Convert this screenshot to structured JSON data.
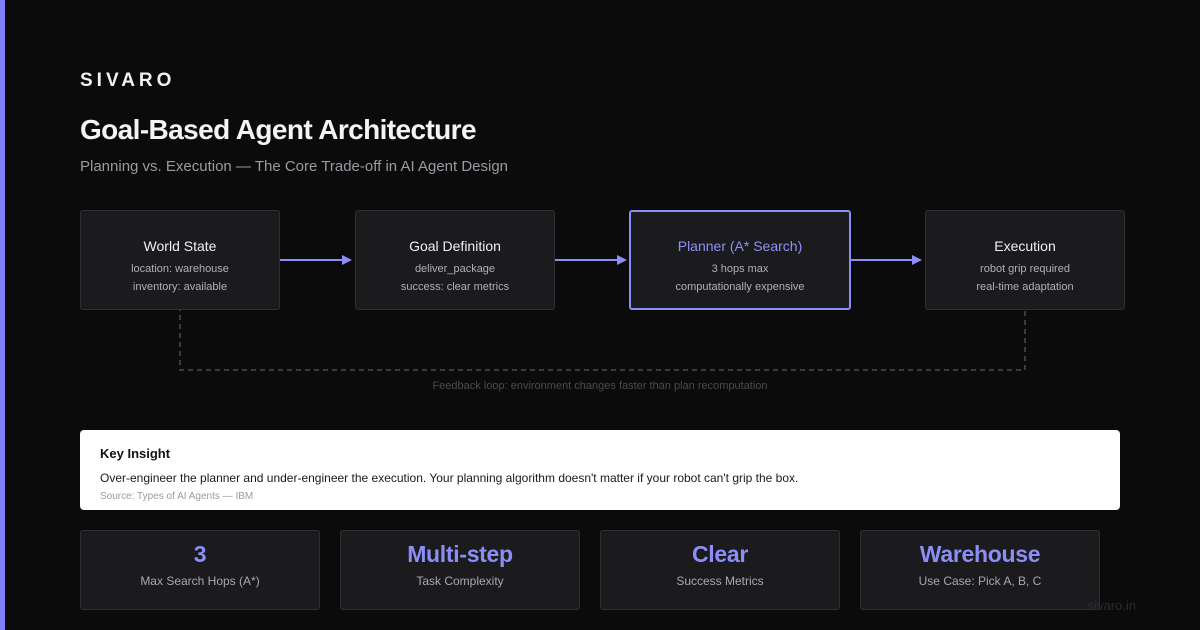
{
  "brand": "SIVARO",
  "title": "Goal-Based Agent Architecture",
  "subtitle": "Planning vs. Execution — The Core Trade-off in AI Agent Design",
  "nodes": [
    {
      "title": "World State",
      "lines": [
        "location: warehouse",
        "inventory: available"
      ]
    },
    {
      "title": "Goal Definition",
      "lines": [
        "deliver_package",
        "success: clear metrics"
      ]
    },
    {
      "title": "Planner (A* Search)",
      "lines": [
        "3 hops max",
        "computationally expensive"
      ]
    },
    {
      "title": "Execution",
      "lines": [
        "robot grip required",
        "real-time adaptation"
      ]
    }
  ],
  "feedback_label": "Feedback loop: environment changes faster than plan recomputation",
  "insight": {
    "title": "Key Insight",
    "body": "Over-engineer the planner and under-engineer the execution. Your planning algorithm doesn't matter if your robot can't grip the box.",
    "source": "Source: Types of AI Agents — IBM"
  },
  "stats": [
    {
      "value": "3",
      "label": "Max Search Hops (A*)"
    },
    {
      "value": "Multi-step",
      "label": "Task Complexity"
    },
    {
      "value": "Clear",
      "label": "Success Metrics"
    },
    {
      "value": "Warehouse",
      "label": "Use Case: Pick A, B, C"
    }
  ],
  "footer": "sivaro.in",
  "colors": {
    "accent": "#8b8ef7",
    "background": "#0b0b0c",
    "card": "#1b1b1e"
  }
}
